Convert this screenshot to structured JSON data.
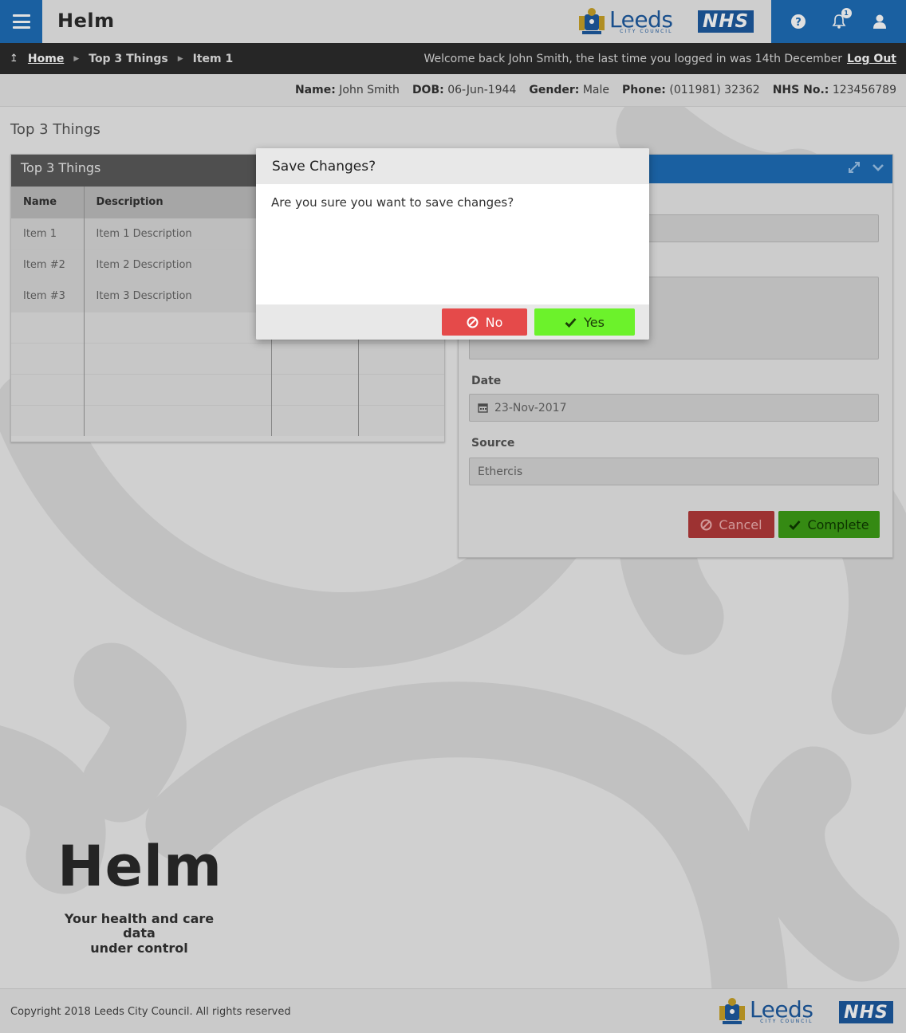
{
  "app": {
    "brand": "Helm"
  },
  "header": {
    "leeds_word": "Leeds",
    "leeds_sub": "CITY COUNCIL",
    "nhs_label": "NHS",
    "notification_count": "1",
    "icons": [
      "menu-icon",
      "help-icon",
      "bell-icon",
      "user-icon"
    ]
  },
  "breadcrumb": {
    "home": "Home",
    "items": [
      "Top 3 Things",
      "Item 1"
    ],
    "welcome": "Welcome back John Smith, the last time you logged in was 14th December",
    "logout": "Log Out"
  },
  "patient": {
    "name_label": "Name:",
    "name": "John Smith",
    "dob_label": "DOB:",
    "dob": "06-Jun-1944",
    "gender_label": "Gender:",
    "gender": "Male",
    "phone_label": "Phone:",
    "phone": "(011981) 32362",
    "nhs_label": "NHS No.:",
    "nhs": "123456789"
  },
  "page_title": "Top 3 Things",
  "table_panel": {
    "title": "Top 3 Things",
    "columns": [
      "Name",
      "Description"
    ],
    "rows": [
      {
        "name": "Item 1",
        "description": "Item 1 Description"
      },
      {
        "name": "Item #2",
        "description": "Item 2 Description"
      },
      {
        "name": "Item #3",
        "description": "Item 3 Description"
      }
    ]
  },
  "detail_panel": {
    "date_label": "Date",
    "date_value": "23-Nov-2017",
    "source_label": "Source",
    "source_value": "Ethercis",
    "cancel_label": "Cancel",
    "complete_label": "Complete"
  },
  "modal": {
    "title": "Save Changes?",
    "message": "Are you sure you want to save changes?",
    "no_label": "No",
    "yes_label": "Yes"
  },
  "big_brand": {
    "word": "Helm",
    "tagline_1": "Your health and care data",
    "tagline_2": "under control"
  },
  "footer": {
    "copyright": "Copyright 2018 Leeds City Council. All rights reserved",
    "leeds_word": "Leeds",
    "leeds_sub": "CITY COUNCIL",
    "nhs_label": "NHS"
  },
  "colors": {
    "primary_blue": "#1e6eb8",
    "nav_dark": "#2c2c2c",
    "danger": "#e54a4a",
    "success": "#6cf22b"
  }
}
